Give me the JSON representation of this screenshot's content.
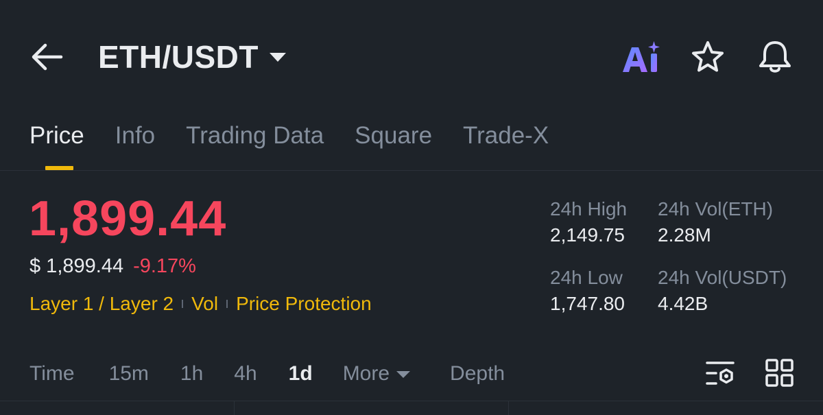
{
  "header": {
    "pair": "ETH/USDT",
    "icons": [
      "back-arrow-icon",
      "chevron-down-icon",
      "ai-icon",
      "star-icon",
      "bell-icon"
    ]
  },
  "tabs": [
    {
      "label": "Price",
      "active": true
    },
    {
      "label": "Info",
      "active": false
    },
    {
      "label": "Trading Data",
      "active": false
    },
    {
      "label": "Square",
      "active": false
    },
    {
      "label": "Trade-X",
      "active": false
    }
  ],
  "price": {
    "last": "1,899.44",
    "usd": "$ 1,899.44",
    "change": "-9.17%"
  },
  "tags": [
    "Layer 1 / Layer 2",
    "Vol",
    "Price Protection"
  ],
  "stats": {
    "high_label": "24h High",
    "high_value": "2,149.75",
    "low_label": "24h Low",
    "low_value": "1,747.80",
    "vol_base_label": "24h Vol(ETH)",
    "vol_base_value": "2.28M",
    "vol_quote_label": "24h Vol(USDT)",
    "vol_quote_value": "4.42B"
  },
  "intervals": {
    "time": "Time",
    "m15": "15m",
    "h1": "1h",
    "h4": "4h",
    "d1": "1d",
    "more": "More",
    "depth": "Depth",
    "active": "1d"
  },
  "colors": {
    "background": "#1e2329",
    "down": "#f6465d",
    "accent": "#f0b90b",
    "muted": "#848e9c",
    "text": "#eaecef"
  }
}
